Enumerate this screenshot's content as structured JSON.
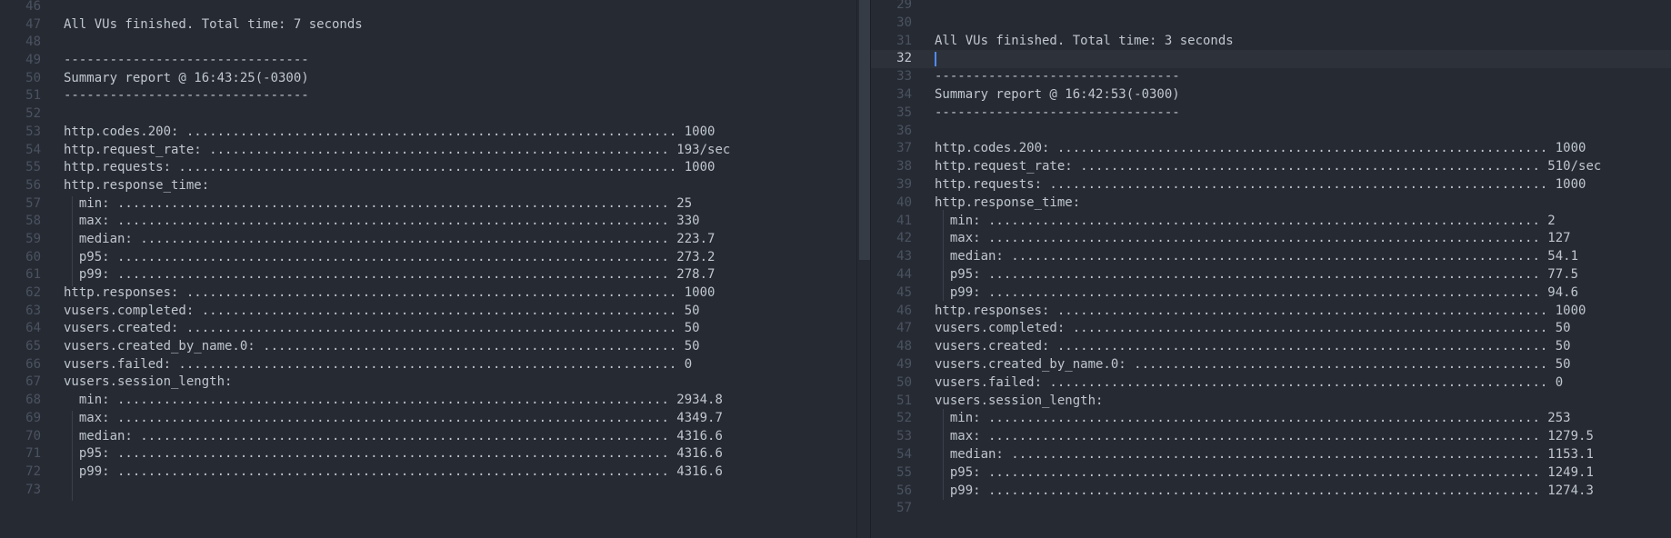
{
  "left_pane": {
    "lines": [
      {
        "n": "46",
        "text": ""
      },
      {
        "n": "47",
        "text": "All VUs finished. Total time: 7 seconds"
      },
      {
        "n": "48",
        "text": ""
      },
      {
        "n": "49",
        "text": "--------------------------------"
      },
      {
        "n": "50",
        "text": "Summary report @ 16:43:25(-0300)"
      },
      {
        "n": "51",
        "text": "--------------------------------"
      },
      {
        "n": "52",
        "text": ""
      },
      {
        "n": "53",
        "text": "http.codes.200: ................................................................ 1000"
      },
      {
        "n": "54",
        "text": "http.request_rate: ............................................................ 193/sec"
      },
      {
        "n": "55",
        "text": "http.requests: ................................................................. 1000"
      },
      {
        "n": "56",
        "text": "http.response_time:"
      },
      {
        "n": "57",
        "text": "  min: ........................................................................ 25"
      },
      {
        "n": "58",
        "text": "  max: ........................................................................ 330"
      },
      {
        "n": "59",
        "text": "  median: ..................................................................... 223.7"
      },
      {
        "n": "60",
        "text": "  p95: ........................................................................ 273.2"
      },
      {
        "n": "61",
        "text": "  p99: ........................................................................ 278.7"
      },
      {
        "n": "62",
        "text": "http.responses: ................................................................ 1000"
      },
      {
        "n": "63",
        "text": "vusers.completed: .............................................................. 50"
      },
      {
        "n": "64",
        "text": "vusers.created: ................................................................ 50"
      },
      {
        "n": "65",
        "text": "vusers.created_by_name.0: ...................................................... 50"
      },
      {
        "n": "66",
        "text": "vusers.failed: ................................................................. 0"
      },
      {
        "n": "67",
        "text": "vusers.session_length:"
      },
      {
        "n": "68",
        "text": "  min: ........................................................................ 2934.8"
      },
      {
        "n": "69",
        "text": "  max: ........................................................................ 4349.7"
      },
      {
        "n": "70",
        "text": "  median: ..................................................................... 4316.6"
      },
      {
        "n": "71",
        "text": "  p95: ........................................................................ 4316.6"
      },
      {
        "n": "72",
        "text": "  p99: ........................................................................ 4316.6"
      },
      {
        "n": "73",
        "text": ""
      }
    ]
  },
  "right_pane": {
    "lines": [
      {
        "n": "29",
        "text": ""
      },
      {
        "n": "30",
        "text": ""
      },
      {
        "n": "31",
        "text": "All VUs finished. Total time: 3 seconds"
      },
      {
        "n": "32",
        "text": ""
      },
      {
        "n": "33",
        "text": "--------------------------------"
      },
      {
        "n": "34",
        "text": "Summary report @ 16:42:53(-0300)"
      },
      {
        "n": "35",
        "text": "--------------------------------"
      },
      {
        "n": "36",
        "text": ""
      },
      {
        "n": "37",
        "text": "http.codes.200: ................................................................ 1000"
      },
      {
        "n": "38",
        "text": "http.request_rate: ............................................................ 510/sec"
      },
      {
        "n": "39",
        "text": "http.requests: ................................................................. 1000"
      },
      {
        "n": "40",
        "text": "http.response_time:"
      },
      {
        "n": "41",
        "text": "  min: ........................................................................ 2"
      },
      {
        "n": "42",
        "text": "  max: ........................................................................ 127"
      },
      {
        "n": "43",
        "text": "  median: ..................................................................... 54.1"
      },
      {
        "n": "44",
        "text": "  p95: ........................................................................ 77.5"
      },
      {
        "n": "45",
        "text": "  p99: ........................................................................ 94.6"
      },
      {
        "n": "46",
        "text": "http.responses: ................................................................ 1000"
      },
      {
        "n": "47",
        "text": "vusers.completed: .............................................................. 50"
      },
      {
        "n": "48",
        "text": "vusers.created: ................................................................ 50"
      },
      {
        "n": "49",
        "text": "vusers.created_by_name.0: ...................................................... 50"
      },
      {
        "n": "50",
        "text": "vusers.failed: ................................................................. 0"
      },
      {
        "n": "51",
        "text": "vusers.session_length:"
      },
      {
        "n": "52",
        "text": "  min: ........................................................................ 253"
      },
      {
        "n": "53",
        "text": "  max: ........................................................................ 1279.5"
      },
      {
        "n": "54",
        "text": "  median: ..................................................................... 1153.1"
      },
      {
        "n": "55",
        "text": "  p95: ........................................................................ 1249.1"
      },
      {
        "n": "56",
        "text": "  p99: ........................................................................ 1274.3"
      },
      {
        "n": "57",
        "text": ""
      }
    ],
    "current_line": "32"
  },
  "colors": {
    "background": "#262b33",
    "text": "#c0c6cf",
    "gutter": "#4b5260",
    "cursor": "#528bff"
  }
}
